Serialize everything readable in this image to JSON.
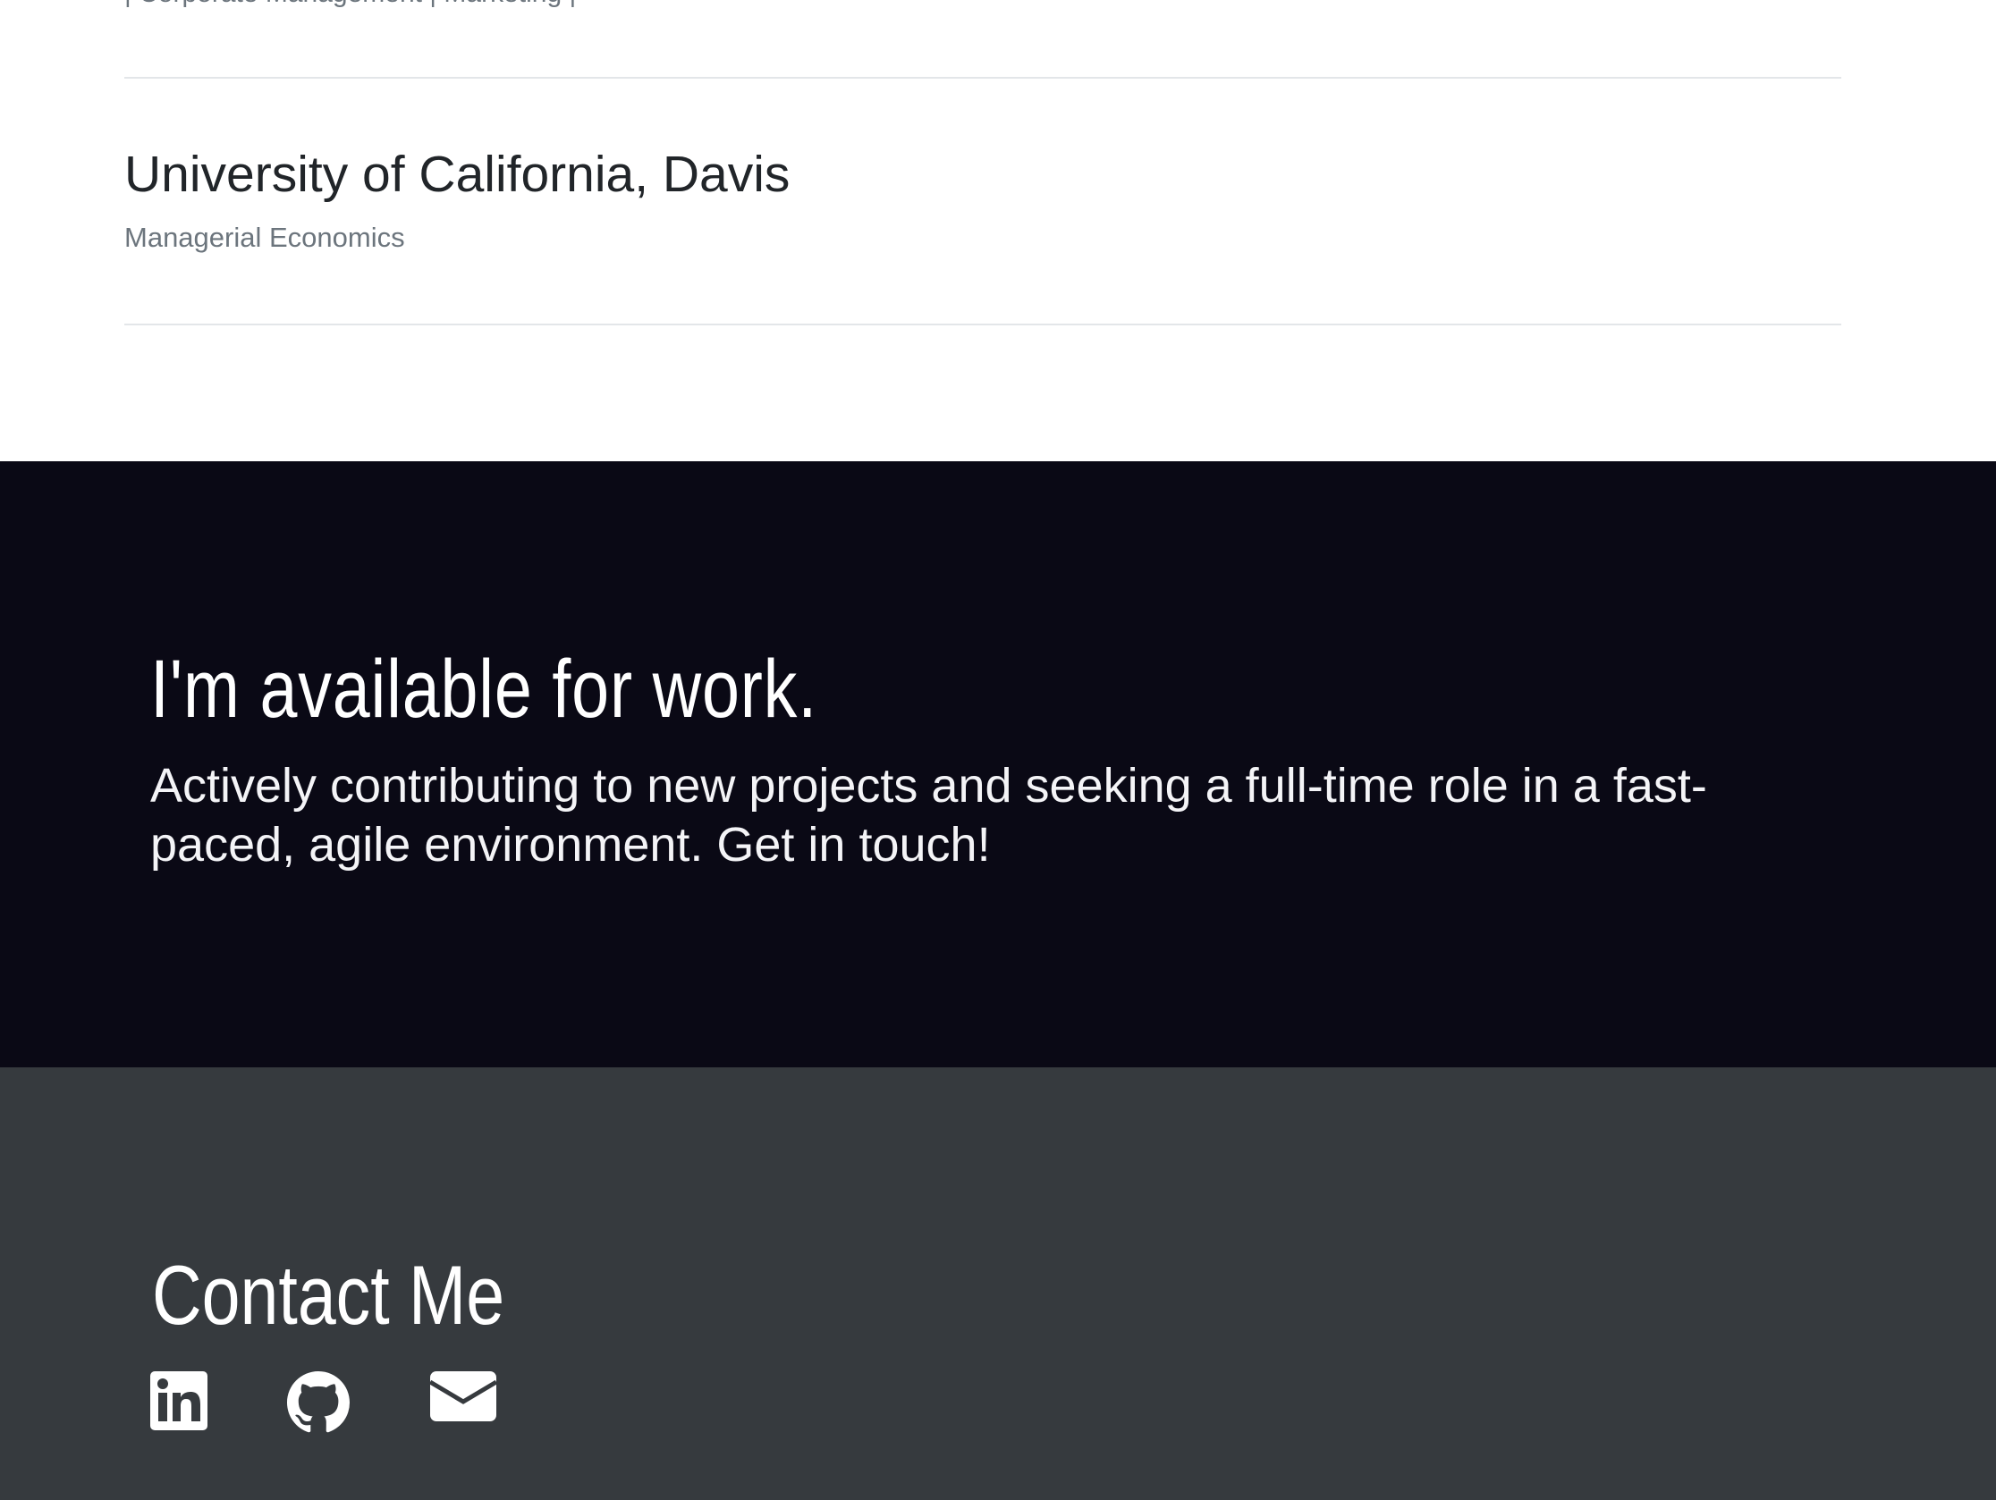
{
  "education": {
    "previous_item_meta": "| Corporate Management | Marketing |",
    "items": [
      {
        "school": "University of California, Davis",
        "major": "Managerial Economics"
      }
    ]
  },
  "availability": {
    "title": "I'm available for work.",
    "text": "Actively contributing to new projects and seeking a full-time role in a fast-paced, agile environment. Get in touch!",
    "background_color": "#0a0915"
  },
  "contact": {
    "title": "Contact Me",
    "background_color": "#363a3e",
    "links": [
      {
        "icon": "linkedin-icon",
        "label": "LinkedIn"
      },
      {
        "icon": "github-icon",
        "label": "GitHub"
      },
      {
        "icon": "envelope-icon",
        "label": "Email"
      }
    ]
  }
}
